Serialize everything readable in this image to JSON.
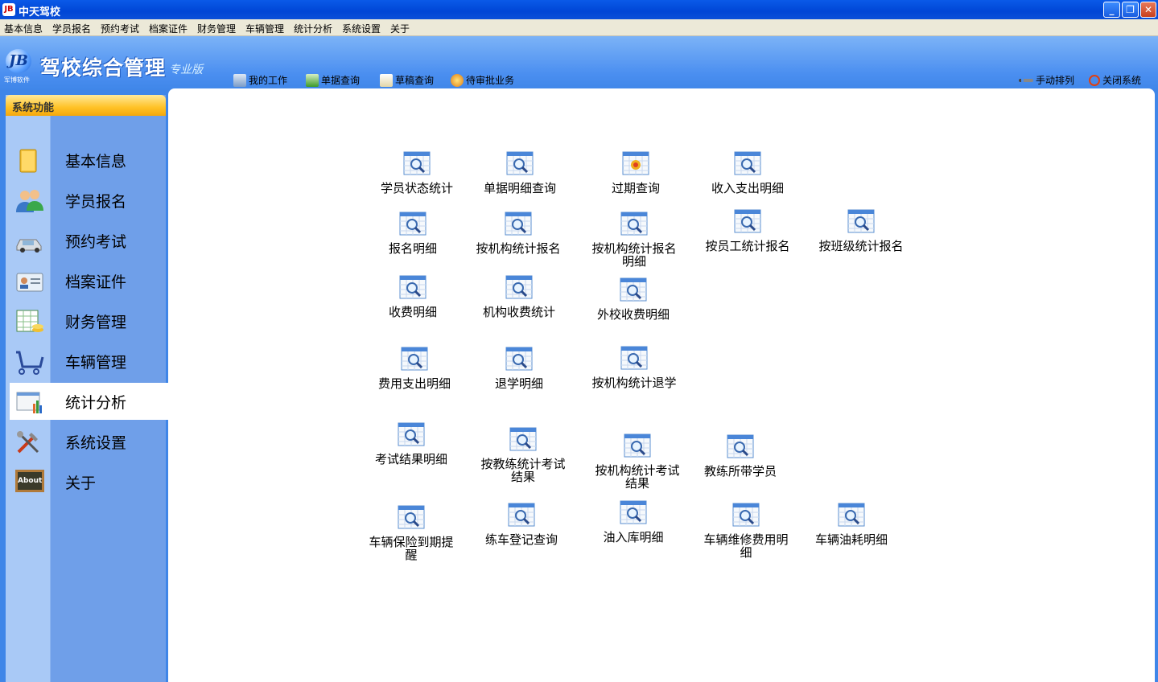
{
  "window": {
    "title": "中天驾校",
    "app_icon_text": "JB"
  },
  "menu": [
    "基本信息",
    "学员报名",
    "预约考试",
    "档案证件",
    "财务管理",
    "车辆管理",
    "统计分析",
    "系统设置",
    "关于"
  ],
  "header": {
    "logo_sub": "军博软件",
    "logo_title": "驾校综合管理",
    "logo_edition": "专业版",
    "tools_left": [
      "我的工作",
      "单据查询",
      "草稿查询",
      "待审批业务"
    ],
    "tools_right": [
      "手动排列",
      "关闭系统"
    ]
  },
  "sidebar": {
    "title": "系统功能",
    "items": [
      {
        "label": "基本信息",
        "icon": "folder-icon"
      },
      {
        "label": "学员报名",
        "icon": "users-icon"
      },
      {
        "label": "预约考试",
        "icon": "car-icon"
      },
      {
        "label": "档案证件",
        "icon": "id-card-icon"
      },
      {
        "label": "财务管理",
        "icon": "finance-icon"
      },
      {
        "label": "车辆管理",
        "icon": "vehicle-icon"
      },
      {
        "label": "统计分析",
        "icon": "chart-icon",
        "active": true
      },
      {
        "label": "系统设置",
        "icon": "tools-icon"
      },
      {
        "label": "关于",
        "icon": "about-board-icon",
        "icon_text": "About"
      }
    ]
  },
  "functions": [
    "学员状态统计",
    "单据明细查询",
    "过期查询",
    "收入支出明细",
    "报名明细",
    "按机构统计报名",
    "按机构统计报名明细",
    "按员工统计报名",
    "按班级统计报名",
    "收费明细",
    "机构收费统计",
    "外校收费明细",
    "费用支出明细",
    "退学明细",
    "按机构统计退学",
    "考试结果明细",
    "按教练统计考试结果",
    "按机构统计考试结果",
    "教练所带学员",
    "车辆保险到期提醒",
    "练车登记查询",
    "油入库明细",
    "车辆维修费用明细",
    "车辆油耗明细"
  ],
  "colors": {
    "titlebar": "#0046d6",
    "sidebar_head": "#ffc226",
    "header": "#4a8ef0"
  }
}
